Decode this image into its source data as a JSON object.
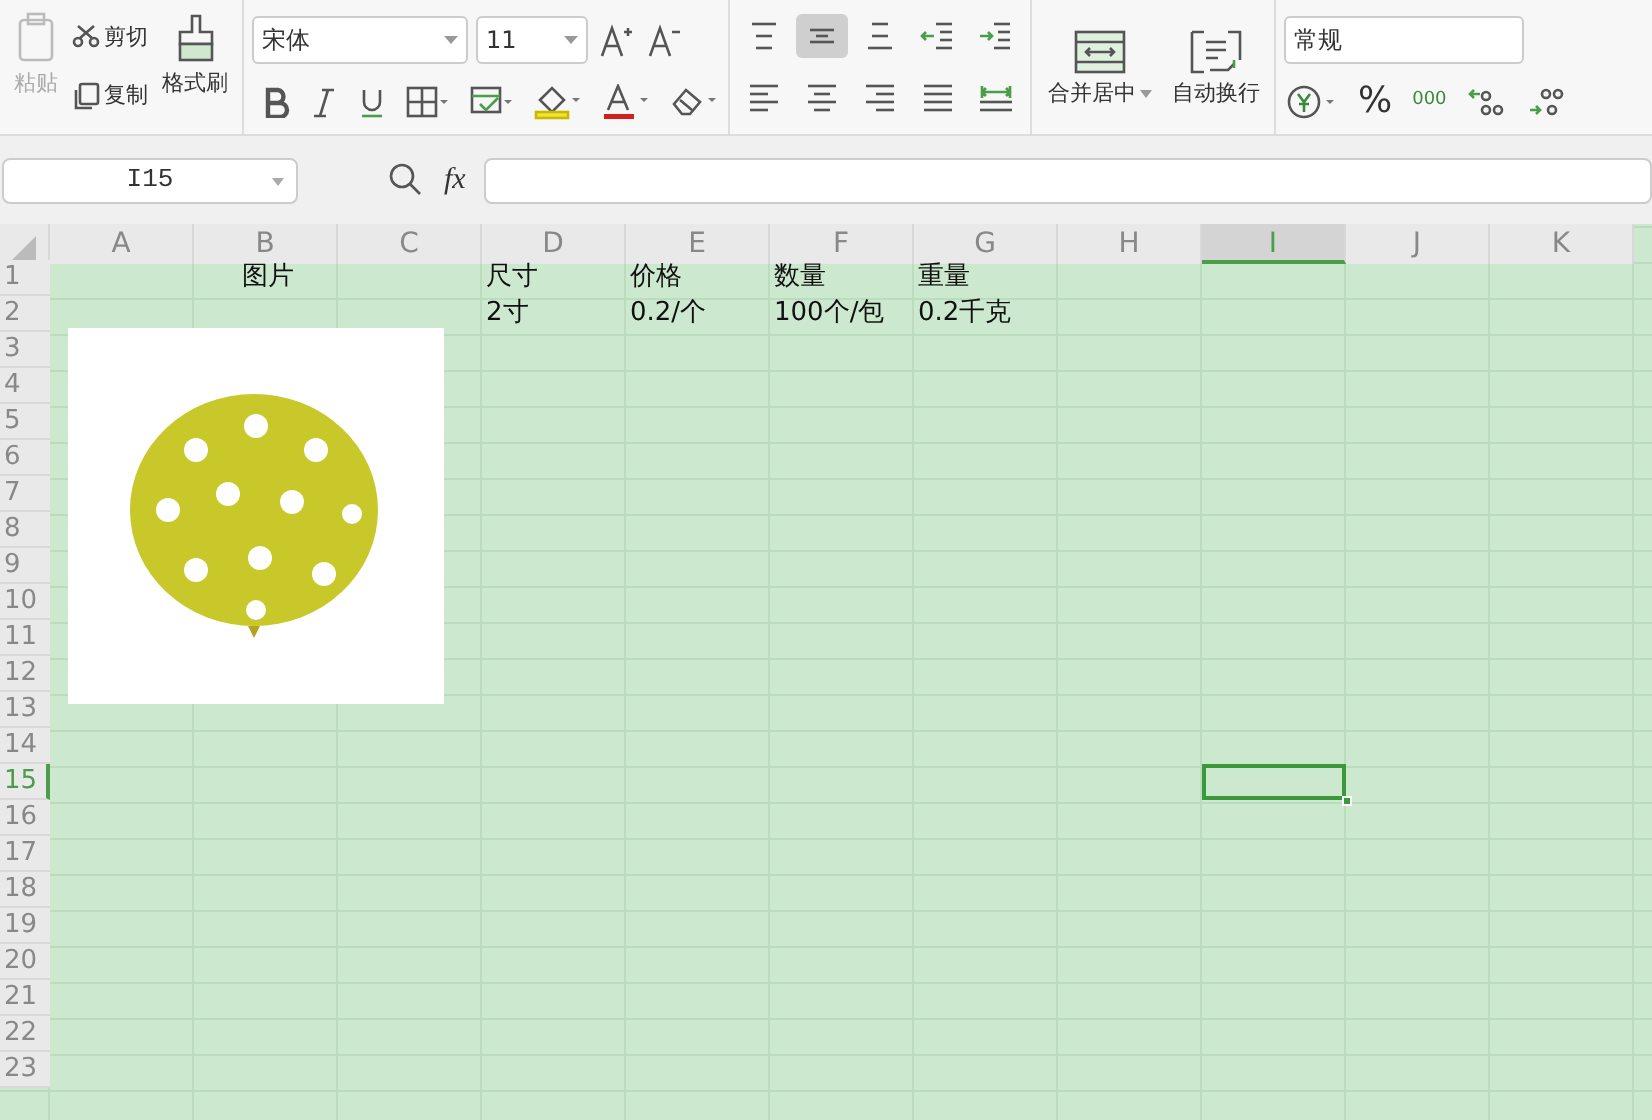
{
  "ribbon": {
    "clipboard": {
      "paste": {
        "label": "粘贴",
        "disabled": true
      },
      "cut": "剪切",
      "copy": "复制",
      "format_painter": "格式刷"
    },
    "font": {
      "name": "宋体",
      "size": "11",
      "buttons": [
        {
          "kind": "grow"
        },
        {
          "kind": "shrink"
        },
        {
          "kind": "bold"
        },
        {
          "kind": "italic"
        },
        {
          "kind": "underline"
        },
        {
          "kind": "border"
        },
        {
          "kind": "fill"
        },
        {
          "kind": "highlight"
        },
        {
          "kind": "color"
        },
        {
          "kind": "clear"
        }
      ]
    },
    "alignment": [
      {
        "kind": "top",
        "selected": false
      },
      {
        "kind": "middle",
        "selected": true
      },
      {
        "kind": "bottom",
        "selected": false
      },
      {
        "kind": "outdent",
        "selected": false
      },
      {
        "kind": "indent",
        "selected": false
      },
      {
        "kind": "left",
        "selected": false
      },
      {
        "kind": "center",
        "selected": false
      },
      {
        "kind": "right",
        "selected": false
      },
      {
        "kind": "justify",
        "selected": false
      },
      {
        "kind": "distributed",
        "selected": false
      }
    ],
    "merge": "合并居中",
    "wrap": "自动换行",
    "number": {
      "format": "常规",
      "percent": "%",
      "thousands": "000"
    }
  },
  "formula_bar": {
    "name_box": "I15",
    "formula": "fx"
  },
  "sheet": {
    "columns": [
      {
        "label": "A",
        "selected": false
      },
      {
        "label": "B",
        "selected": false
      },
      {
        "label": "C",
        "selected": false
      },
      {
        "label": "D",
        "selected": false
      },
      {
        "label": "E",
        "selected": false
      },
      {
        "label": "F",
        "selected": false
      },
      {
        "label": "G",
        "selected": false
      },
      {
        "label": "H",
        "selected": false
      },
      {
        "label": "I",
        "selected": true
      },
      {
        "label": "J",
        "selected": false
      },
      {
        "label": "K",
        "selected": false
      }
    ],
    "rows": [
      {
        "number": "1",
        "selected": false,
        "cells": [
          null,
          "图片",
          null,
          "尺寸",
          "价格",
          "数量",
          "重量"
        ]
      },
      {
        "number": "2",
        "selected": false,
        "cells": [
          null,
          null,
          null,
          "2寸",
          "0.2/个",
          "100个/包",
          "0.2千克"
        ]
      },
      {
        "number": "3",
        "selected": false
      },
      {
        "number": "4",
        "selected": false
      },
      {
        "number": "5",
        "selected": false
      },
      {
        "number": "6",
        "selected": false
      },
      {
        "number": "7",
        "selected": false
      },
      {
        "number": "8",
        "selected": false
      },
      {
        "number": "9",
        "selected": false
      },
      {
        "number": "10",
        "selected": false
      },
      {
        "number": "11",
        "selected": false
      },
      {
        "number": "12",
        "selected": false
      },
      {
        "number": "13",
        "selected": false
      },
      {
        "number": "14",
        "selected": false
      },
      {
        "number": "15",
        "selected": true
      },
      {
        "number": "16",
        "selected": false
      },
      {
        "number": "17",
        "selected": false
      },
      {
        "number": "18",
        "selected": false
      },
      {
        "number": "19",
        "selected": false
      },
      {
        "number": "20",
        "selected": false
      },
      {
        "number": "21",
        "selected": false
      },
      {
        "number": "22",
        "selected": false
      },
      {
        "number": "23",
        "selected": false
      }
    ]
  }
}
